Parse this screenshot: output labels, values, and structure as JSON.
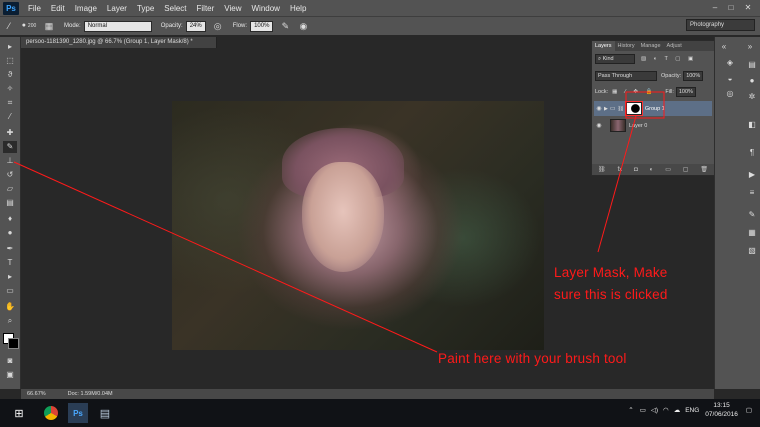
{
  "app": {
    "logo": "Ps"
  },
  "menu": [
    "File",
    "Edit",
    "Image",
    "Layer",
    "Type",
    "Select",
    "Filter",
    "View",
    "Window",
    "Help"
  ],
  "window_controls": [
    "–",
    "□",
    "✕"
  ],
  "options_bar": {
    "brush_size": "200",
    "mode_label": "Mode:",
    "mode_value": "Normal",
    "opacity_label": "Opacity:",
    "opacity_value": "24%",
    "flow_label": "Flow:",
    "flow_value": "100%",
    "workspace": "Photography"
  },
  "document_tab": "persoo-1181390_1280.jpg @ 66.7% (Group 1, Layer Mask/8) *",
  "layers_panel": {
    "tabs": [
      "Layers",
      "History",
      "Manage",
      "Adjust"
    ],
    "kind_label": "Kind",
    "blend_mode": "Pass Through",
    "opacity_label": "Opacity:",
    "opacity_value": "100%",
    "lock_label": "Lock:",
    "fill_label": "Fill:",
    "fill_value": "100%",
    "layers": [
      {
        "name": "Group 1"
      },
      {
        "name": "Layer 0"
      }
    ]
  },
  "status": {
    "zoom": "66.67%",
    "doc": "Doc: 1.59M/0.04M"
  },
  "taskbar": {
    "tray_lang": "ENG",
    "time": "13:15",
    "date": "07/06/2016"
  },
  "annotations": {
    "mask_line1": "Layer Mask, Make",
    "mask_line2": "sure this is clicked",
    "paint": "Paint here with your brush tool"
  },
  "colors": {
    "annotation": "#ff1a1a",
    "selected_layer": "#5d6f87"
  }
}
